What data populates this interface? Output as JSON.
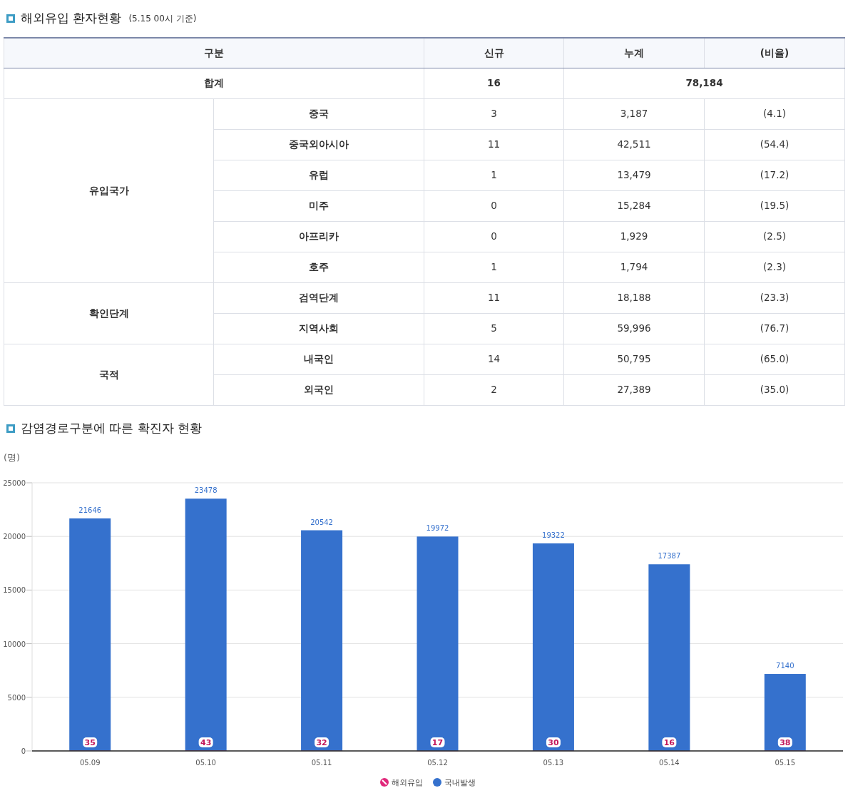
{
  "section_1": {
    "title": "해외유입 환자현황",
    "note": "(5.15 00시 기준)",
    "table": {
      "columns": [
        "구분",
        "신규",
        "누계",
        "(비율)"
      ],
      "total": {
        "label": "합계",
        "new": "16",
        "cumulative": "78,184"
      },
      "groups": [
        {
          "label": "유입국가",
          "rows": [
            {
              "label": "중국",
              "new": "3",
              "cumulative": "3,187",
              "ratio": "(4.1)"
            },
            {
              "label": "중국외아시아",
              "new": "11",
              "cumulative": "42,511",
              "ratio": "(54.4)"
            },
            {
              "label": "유럽",
              "new": "1",
              "cumulative": "13,479",
              "ratio": "(17.2)"
            },
            {
              "label": "미주",
              "new": "0",
              "cumulative": "15,284",
              "ratio": "(19.5)"
            },
            {
              "label": "아프리카",
              "new": "0",
              "cumulative": "1,929",
              "ratio": "(2.5)"
            },
            {
              "label": "호주",
              "new": "1",
              "cumulative": "1,794",
              "ratio": "(2.3)"
            }
          ]
        },
        {
          "label": "확인단계",
          "rows": [
            {
              "label": "검역단계",
              "new": "11",
              "cumulative": "18,188",
              "ratio": "(23.3)"
            },
            {
              "label": "지역사회",
              "new": "5",
              "cumulative": "59,996",
              "ratio": "(76.7)"
            }
          ]
        },
        {
          "label": "국적",
          "rows": [
            {
              "label": "내국인",
              "new": "14",
              "cumulative": "50,795",
              "ratio": "(65.0)"
            },
            {
              "label": "외국인",
              "new": "2",
              "cumulative": "27,389",
              "ratio": "(35.0)"
            }
          ]
        }
      ]
    }
  },
  "section_2": {
    "title": "감염경로구분에 따른 확진자 현황",
    "chart_data": {
      "type": "bar",
      "ylabel": "(명)",
      "stacked": true,
      "data_labels": true,
      "categories": [
        "05.09",
        "05.10",
        "05.11",
        "05.12",
        "05.13",
        "05.14",
        "05.15"
      ],
      "series": [
        {
          "name": "해외유입",
          "color": "#e0287a",
          "values": [
            35,
            43,
            32,
            17,
            30,
            16,
            38
          ]
        },
        {
          "name": "국내발생",
          "color": "#3571cd",
          "values": [
            21646,
            23478,
            20542,
            19972,
            19322,
            17387,
            7140
          ]
        }
      ],
      "grid": true,
      "legend": true,
      "ylim": [
        0,
        25000
      ],
      "yticks": [
        0,
        5000,
        10000,
        15000,
        20000,
        25000
      ]
    }
  }
}
